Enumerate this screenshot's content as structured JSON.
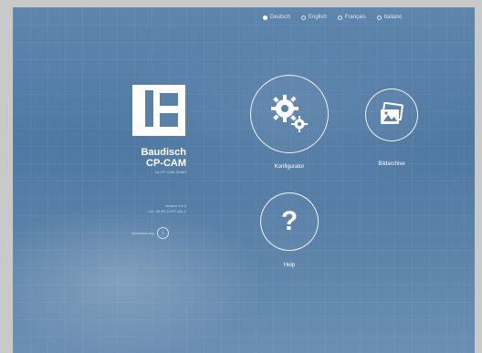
{
  "languages": [
    {
      "label": "Deutsch",
      "active": true
    },
    {
      "label": "English",
      "active": false
    },
    {
      "label": "Français",
      "active": false
    },
    {
      "label": "Italiano",
      "active": false
    }
  ],
  "brand": {
    "line1": "Baudisch",
    "line2": "CP-CAM",
    "tagline": "by CP-CAM GmbH"
  },
  "info": {
    "line1": "Version 3.6.0",
    "line2": "Lic. 39-PKJ-SYF-QU-Z"
  },
  "language_button_label": "Sprache/Lang",
  "tiles": {
    "konfigurator": {
      "label": "Konfigurator",
      "icon": "gears-icon"
    },
    "bildarchive": {
      "label": "Bildarchive",
      "icon": "photo-album-icon"
    },
    "help": {
      "label": "Help",
      "icon": "question-mark-icon"
    }
  },
  "colors": {
    "background": "#5a81a8",
    "accent": "#ffffff"
  }
}
